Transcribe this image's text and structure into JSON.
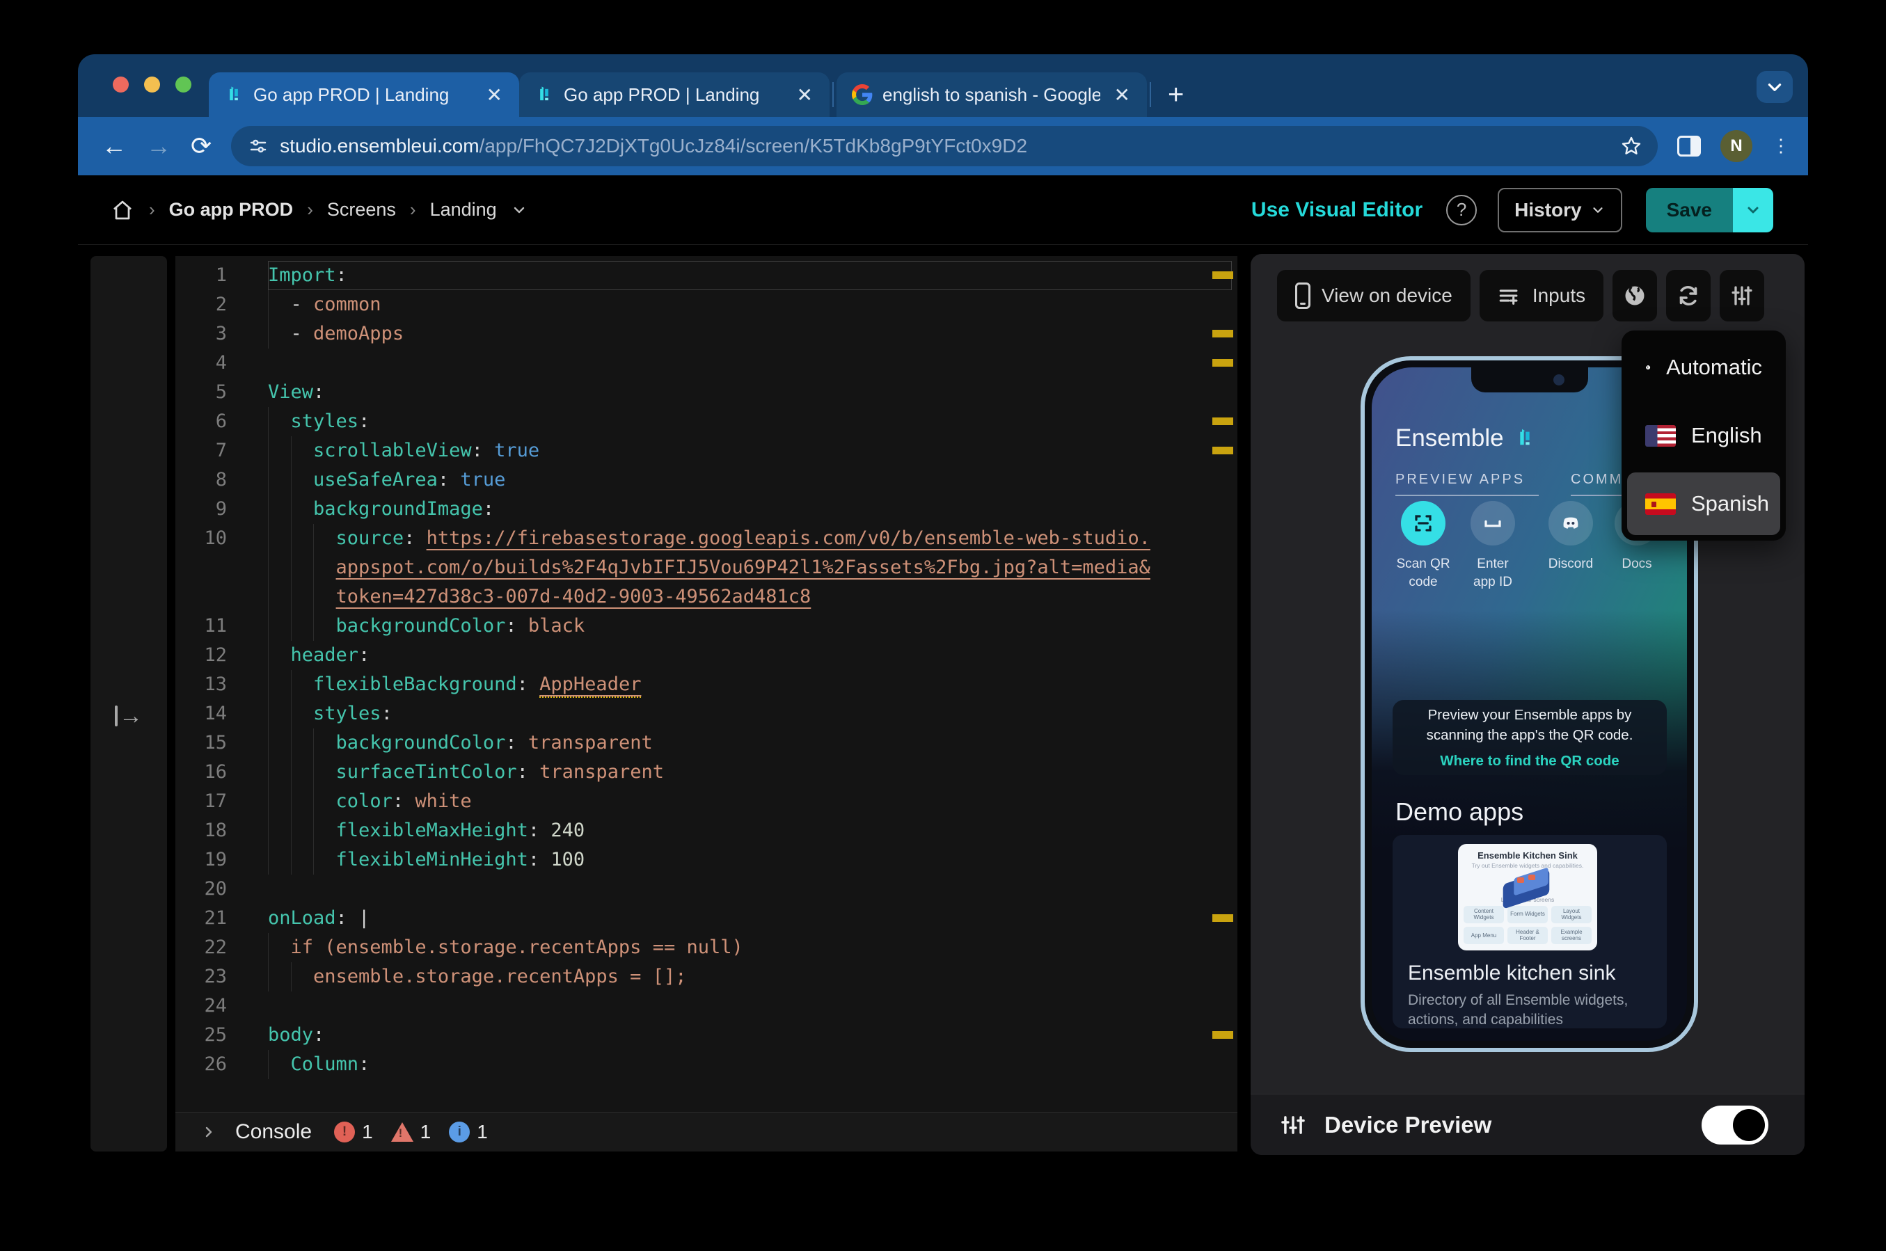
{
  "colors": {
    "chrome-dark": "#123a63",
    "chrome-blue": "#1d5fa5",
    "accent-cyan": "#25d9d9",
    "save-teal": "#16807f",
    "save-chevron": "#3ae6e6",
    "code-key": "#45c5ad",
    "code-string": "#ce9178",
    "code-bool": "#569cd6",
    "code-text": "#d4d4d4",
    "warning-marker": "#c9a30f",
    "error-red": "#e06156",
    "warn-orange": "#e0766a",
    "info-blue": "#5b9ce6",
    "phone-cyan": "#35dfe6"
  },
  "browser": {
    "tabs": [
      {
        "title": "Go app PROD | Landing",
        "close": "✕"
      },
      {
        "title": "Go app PROD | Landing",
        "close": "✕"
      },
      {
        "title": "english to spanish - Google S",
        "close": "✕"
      }
    ],
    "new_tab": "+",
    "url_host": "studio.ensembleui.com",
    "url_path": "/app/FhQC7J2DjXTg0UcJz84i/screen/K5TdKb8gP9tYFct0x9D2",
    "avatar_initial": "N",
    "kebab": "⋮",
    "back": "←",
    "forward": "→",
    "reload": "⟳"
  },
  "header": {
    "breadcrumb": [
      "Go app PROD",
      "Screens",
      "Landing"
    ],
    "separator": "›",
    "visual_editor": "Use Visual Editor",
    "help": "?",
    "history": "History",
    "save": "Save"
  },
  "editor": {
    "rows": [
      {
        "num": "1",
        "g": 0,
        "active": true,
        "seg": [
          {
            "t": "Import",
            "c": "k"
          },
          {
            "t": ":",
            "c": "p"
          }
        ]
      },
      {
        "num": "2",
        "g": 1,
        "seg": [
          {
            "t": "  - ",
            "c": "p"
          },
          {
            "t": "common",
            "c": "s"
          }
        ]
      },
      {
        "num": "3",
        "g": 1,
        "seg": [
          {
            "t": "  - ",
            "c": "p"
          },
          {
            "t": "demoApps",
            "c": "s"
          }
        ]
      },
      {
        "num": "4",
        "g": 0,
        "seg": []
      },
      {
        "num": "5",
        "g": 0,
        "seg": [
          {
            "t": "View",
            "c": "k"
          },
          {
            "t": ":",
            "c": "p"
          }
        ]
      },
      {
        "num": "6",
        "g": 1,
        "seg": [
          {
            "t": "  ",
            "c": "p"
          },
          {
            "t": "styles",
            "c": "k"
          },
          {
            "t": ":",
            "c": "p"
          }
        ]
      },
      {
        "num": "7",
        "g": 2,
        "seg": [
          {
            "t": "    ",
            "c": "p"
          },
          {
            "t": "scrollableView",
            "c": "k"
          },
          {
            "t": ": ",
            "c": "p"
          },
          {
            "t": "true",
            "c": "b"
          }
        ]
      },
      {
        "num": "8",
        "g": 2,
        "seg": [
          {
            "t": "    ",
            "c": "p"
          },
          {
            "t": "useSafeArea",
            "c": "k"
          },
          {
            "t": ": ",
            "c": "p"
          },
          {
            "t": "true",
            "c": "b"
          }
        ]
      },
      {
        "num": "9",
        "g": 2,
        "seg": [
          {
            "t": "    ",
            "c": "p"
          },
          {
            "t": "backgroundImage",
            "c": "k"
          },
          {
            "t": ":",
            "c": "p"
          }
        ]
      },
      {
        "num": "10",
        "g": 3,
        "seg": [
          {
            "t": "      ",
            "c": "p"
          },
          {
            "t": "source",
            "c": "k"
          },
          {
            "t": ": ",
            "c": "p"
          },
          {
            "t": "https://firebasestorage.googleapis.com/v0/b/ensemble-web-studio.",
            "c": "l"
          }
        ]
      },
      {
        "num": "",
        "g": 3,
        "seg": [
          {
            "t": "      ",
            "c": "p"
          },
          {
            "t": "appspot.com/o/builds%2F4qJvbIFIJ5Vou69P42l1%2Fassets%2Fbg.jpg?alt=media&",
            "c": "l"
          }
        ]
      },
      {
        "num": "",
        "g": 3,
        "seg": [
          {
            "t": "      ",
            "c": "p"
          },
          {
            "t": "token=427d38c3-007d-40d2-9003-49562ad481c8",
            "c": "l"
          }
        ]
      },
      {
        "num": "11",
        "g": 3,
        "seg": [
          {
            "t": "      ",
            "c": "p"
          },
          {
            "t": "backgroundColor",
            "c": "k"
          },
          {
            "t": ": ",
            "c": "p"
          },
          {
            "t": "black",
            "c": "s"
          }
        ]
      },
      {
        "num": "12",
        "g": 1,
        "seg": [
          {
            "t": "  ",
            "c": "p"
          },
          {
            "t": "header",
            "c": "k"
          },
          {
            "t": ":",
            "c": "p"
          }
        ]
      },
      {
        "num": "13",
        "g": 2,
        "seg": [
          {
            "t": "    ",
            "c": "p"
          },
          {
            "t": "flexibleBackground",
            "c": "k"
          },
          {
            "t": ": ",
            "c": "p"
          },
          {
            "t": "AppHeader",
            "c": "w"
          }
        ]
      },
      {
        "num": "14",
        "g": 2,
        "seg": [
          {
            "t": "    ",
            "c": "p"
          },
          {
            "t": "styles",
            "c": "k"
          },
          {
            "t": ":",
            "c": "p"
          }
        ]
      },
      {
        "num": "15",
        "g": 3,
        "seg": [
          {
            "t": "      ",
            "c": "p"
          },
          {
            "t": "backgroundColor",
            "c": "k"
          },
          {
            "t": ": ",
            "c": "p"
          },
          {
            "t": "transparent",
            "c": "s"
          }
        ]
      },
      {
        "num": "16",
        "g": 3,
        "seg": [
          {
            "t": "      ",
            "c": "p"
          },
          {
            "t": "surfaceTintColor",
            "c": "k"
          },
          {
            "t": ": ",
            "c": "p"
          },
          {
            "t": "transparent",
            "c": "s"
          }
        ]
      },
      {
        "num": "17",
        "g": 3,
        "seg": [
          {
            "t": "      ",
            "c": "p"
          },
          {
            "t": "color",
            "c": "k"
          },
          {
            "t": ": ",
            "c": "p"
          },
          {
            "t": "white",
            "c": "s"
          }
        ]
      },
      {
        "num": "18",
        "g": 3,
        "seg": [
          {
            "t": "      ",
            "c": "p"
          },
          {
            "t": "flexibleMaxHeight",
            "c": "k"
          },
          {
            "t": ": ",
            "c": "p"
          },
          {
            "t": "240",
            "c": "n"
          }
        ]
      },
      {
        "num": "19",
        "g": 3,
        "seg": [
          {
            "t": "      ",
            "c": "p"
          },
          {
            "t": "flexibleMinHeight",
            "c": "k"
          },
          {
            "t": ": ",
            "c": "p"
          },
          {
            "t": "100",
            "c": "n"
          }
        ]
      },
      {
        "num": "20",
        "g": 0,
        "seg": []
      },
      {
        "num": "21",
        "g": 0,
        "seg": [
          {
            "t": "onLoad",
            "c": "k"
          },
          {
            "t": ": |",
            "c": "p"
          }
        ]
      },
      {
        "num": "22",
        "g": 1,
        "seg": [
          {
            "t": "  ",
            "c": "p"
          },
          {
            "t": "if (ensemble.storage.recentApps == null)",
            "c": "s"
          }
        ]
      },
      {
        "num": "23",
        "g": 2,
        "seg": [
          {
            "t": "    ",
            "c": "p"
          },
          {
            "t": "ensemble.storage.recentApps = [];",
            "c": "s"
          }
        ]
      },
      {
        "num": "24",
        "g": 0,
        "seg": []
      },
      {
        "num": "25",
        "g": 0,
        "seg": [
          {
            "t": "body",
            "c": "k"
          },
          {
            "t": ":",
            "c": "p"
          }
        ]
      },
      {
        "num": "26",
        "g": 1,
        "seg": [
          {
            "t": "  ",
            "c": "p"
          },
          {
            "t": "Column",
            "c": "k"
          },
          {
            "t": ":",
            "c": "p"
          }
        ]
      }
    ],
    "warning_marker_rows": [
      1,
      3,
      4,
      6,
      7,
      23,
      27
    ]
  },
  "console": {
    "label": "Console",
    "error_count": "1",
    "warning_count": "1",
    "info_count": "1"
  },
  "preview": {
    "toolbar": {
      "view_on_device": "View on device",
      "inputs": "Inputs"
    },
    "dropdown": {
      "items": [
        {
          "label": "Automatic"
        },
        {
          "label": "English"
        },
        {
          "label": "Spanish"
        }
      ]
    },
    "phone": {
      "brand": "Ensemble",
      "section_tabs": [
        "PREVIEW APPS",
        "COMMUNITY &"
      ],
      "quick_actions": [
        {
          "line1": "Scan QR",
          "line2": "code"
        },
        {
          "line1": "Enter",
          "line2": "app ID"
        },
        {
          "line1": "Discord",
          "line2": ""
        },
        {
          "line1": "Docs",
          "line2": ""
        }
      ],
      "info_card": {
        "text": "Preview your Ensemble apps by scanning the app's the QR code.",
        "link": "Where to find the QR code"
      },
      "demo_heading": "Demo apps",
      "demo_card": {
        "screenshot_title": "Ensemble Kitchen Sink",
        "screenshot_subtitle": "Try out Ensemble widgets and capabilities.",
        "screenshot_caption": "Layout your screens",
        "chips": [
          "Content Widgets",
          "Form Widgets",
          "Layout Widgets",
          "App Menu",
          "Header & Footer",
          "Example screens"
        ],
        "title": "Ensemble kitchen sink",
        "subtitle": "Directory of all Ensemble widgets, actions, and capabilities"
      }
    },
    "footer": {
      "label": "Device Preview"
    }
  }
}
